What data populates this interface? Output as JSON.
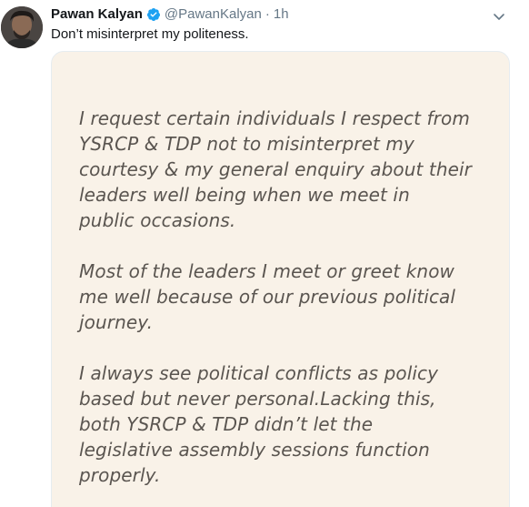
{
  "author": {
    "display_name": "Pawan Kalyan",
    "handle": "@PawanKalyan",
    "separator": "·",
    "timestamp": "1h",
    "verified": true
  },
  "tweet": {
    "text": "Don’t misinterpret my politeness."
  },
  "media": {
    "paragraphs": [
      "I request certain individuals I respect from\nYSRCP & TDP  not to misinterpret my\ncourtesy & my general enquiry about their\nleaders well being when we  meet in\npublic occasions.",
      "Most of the leaders I meet or greet  know\nme well because of our previous political\njourney.",
      "I always see political conflicts as policy\nbased but never personal.Lacking this,\nboth  YSRCP & TDP didn’t let the\nlegislative assembly sessions function\nproperly."
    ]
  },
  "icons": {
    "verified": "verified-badge-icon",
    "caret": "chevron-down-icon"
  },
  "colors": {
    "verified_blue": "#1da1f2",
    "media_background": "#f9f2e8",
    "secondary_text": "#657786"
  }
}
